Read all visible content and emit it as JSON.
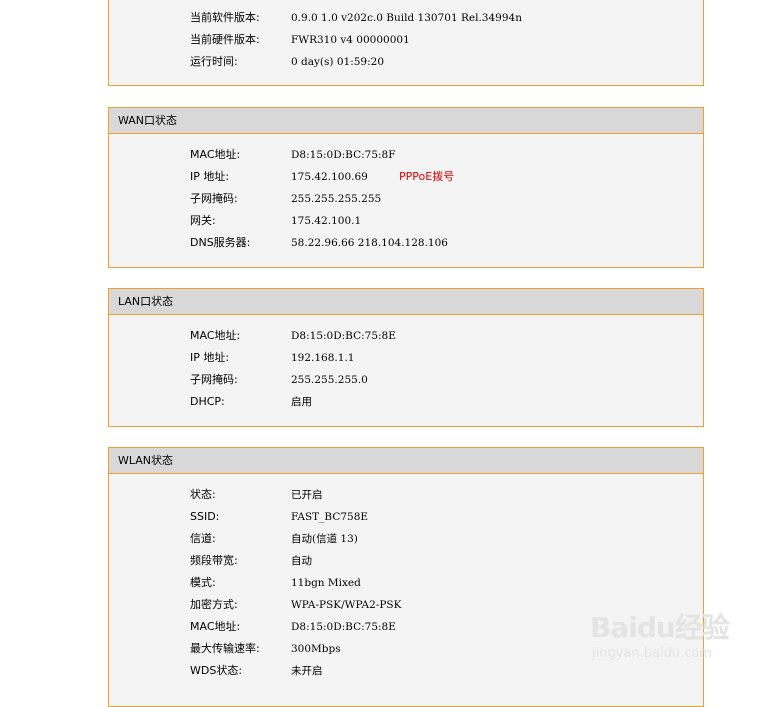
{
  "sys": {
    "rows": [
      {
        "label": "当前软件版本:",
        "value": "0.9.0 1.0 v202c.0 Build 130701 Rel.34994n"
      },
      {
        "label": "当前硬件版本:",
        "value": "FWR310 v4 00000001"
      },
      {
        "label": "运行时间:",
        "value": "0 day(s) 01:59:20"
      }
    ]
  },
  "wan": {
    "title": "WAN口状态",
    "rows": [
      {
        "label": "MAC地址:",
        "value": "D8:15:0D:BC:75:8F"
      },
      {
        "label": "IP 地址:",
        "value": "175.42.100.69",
        "extra": "PPPoE拨号"
      },
      {
        "label": "子网掩码:",
        "value": "255.255.255.255"
      },
      {
        "label": "网关:",
        "value": "175.42.100.1"
      },
      {
        "label": "DNS服务器:",
        "value": "58.22.96.66 218.104.128.106"
      }
    ]
  },
  "lan": {
    "title": "LAN口状态",
    "rows": [
      {
        "label": "MAC地址:",
        "value": "D8:15:0D:BC:75:8E"
      },
      {
        "label": "IP 地址:",
        "value": "192.168.1.1"
      },
      {
        "label": "子网掩码:",
        "value": "255.255.255.0"
      },
      {
        "label": "DHCP:",
        "value": "启用"
      }
    ]
  },
  "wlan": {
    "title": "WLAN状态",
    "rows": [
      {
        "label": "状态:",
        "value": "已开启"
      },
      {
        "label": "SSID:",
        "value": "FAST_BC758E"
      },
      {
        "label": "信道:",
        "value": "自动(信道 13)"
      },
      {
        "label": "频段带宽:",
        "value": "自动"
      },
      {
        "label": "模式:",
        "value": "11bgn Mixed"
      },
      {
        "label": "加密方式:",
        "value": "WPA-PSK/WPA2-PSK"
      },
      {
        "label": "MAC地址:",
        "value": "D8:15:0D:BC:75:8E"
      },
      {
        "label": "最大传输速率:",
        "value": "300Mbps"
      },
      {
        "label": "WDS状态:",
        "value": "未开启"
      }
    ]
  },
  "watermark": {
    "logo": "Baidu经验",
    "url": "jingyan.baidu.com"
  }
}
